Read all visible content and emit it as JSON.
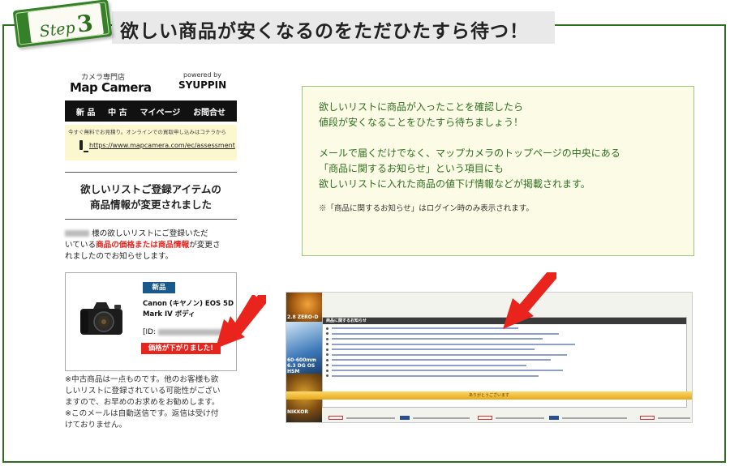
{
  "step": {
    "word": "Step",
    "number": "3"
  },
  "headline": "欲しい商品が安くなるのをただひたすら待つ！",
  "phone": {
    "brand_sub": "カメラ専門店",
    "brand": "Map Camera",
    "powered_by": "powered by",
    "partner": "SYUPPIN",
    "nav": [
      "新 品",
      "中 古",
      "マイページ",
      "お問合せ"
    ],
    "notice_text": "今すぐ無料でお見積り。オンラインでの買取申し込みはコチラから",
    "notice_url": "https://www.mapcamera.com/ec/assessment",
    "title_line1": "欲しいリストご登録アイテムの",
    "title_line2": "商品情報が変更されました",
    "body_prefix": "様の欲しいリストにご登録いただ",
    "body_line2_a": "いている",
    "body_highlight": "商品の価格または商品情報",
    "body_line2_b": "が変更さ",
    "body_line3": "れましたのでお知らせします。",
    "product": {
      "badge": "新品",
      "name_line1": "Canon (キヤノン) EOS 5D",
      "name_line2": "Mark IV ボディ",
      "id_label": "[ID:",
      "price_status": "価格が下がりました!"
    },
    "footer_lines": [
      "※中古商品は一点ものです。他のお客様も欲",
      "しいリストに登録されている可能性がござい",
      "ますので、お早めのお求めをお勧めします。",
      "※このメールは自動送信です。返信は受け付",
      "けておりません。"
    ]
  },
  "info": {
    "para1": [
      "欲しいリストに商品が入ったことを確認したら",
      "値段が安くなることをひたすら待ちましょう！"
    ],
    "para2": [
      "メールで届くだけでなく、マップカメラのトップページの中央にある",
      "「商品に関するお知らせ」という項目にも",
      "欲しいリストに入れた商品の値下げ情報などが掲載されます。"
    ],
    "note": "※「商品に関するお知らせ」はログイン時のみ表示されます。"
  },
  "site": {
    "thumb_labels": [
      "2.8 ZERO-D",
      "60-600mm\n6.3 DG OS HSM",
      "NIKKOR"
    ],
    "panel_title": "商品に関するお知らせ",
    "gold_text": "ありがとうございます",
    "row_count": 10
  },
  "colors": {
    "frame": "#2d6f1f",
    "accent_red": "#e8241c",
    "info_bg": "#fcfce6",
    "nav_bg": "#111111"
  }
}
